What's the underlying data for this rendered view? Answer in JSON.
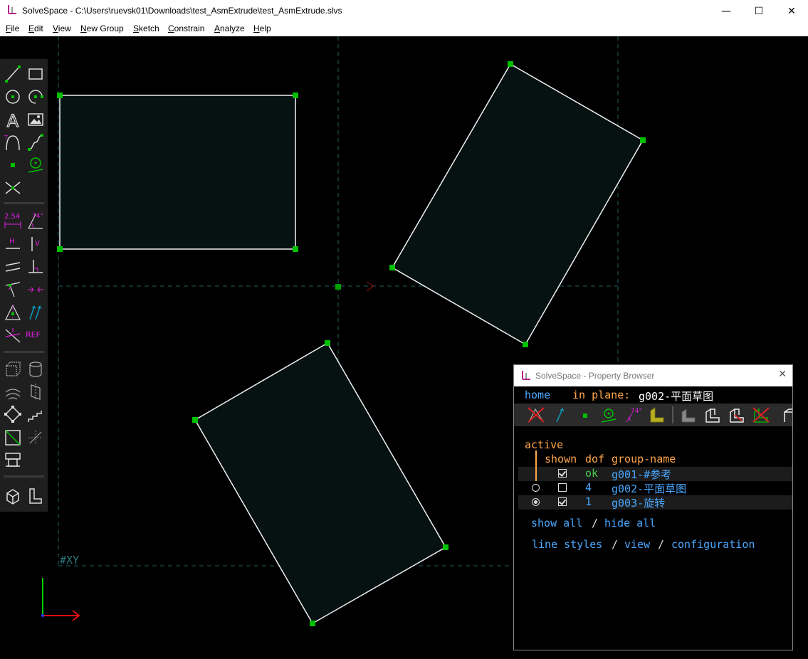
{
  "window": {
    "title": "SolveSpace - C:\\Users\\ruevsk01\\Downloads\\test_AsmExtrude\\test_AsmExtrude.slvs",
    "minimize": "—",
    "maximize": "☐",
    "close": "✕"
  },
  "menu": [
    {
      "u": "F",
      "rest": "ile"
    },
    {
      "u": "E",
      "rest": "dit"
    },
    {
      "u": "V",
      "rest": "iew"
    },
    {
      "u": "N",
      "rest": "ew Group"
    },
    {
      "u": "S",
      "rest": "ketch"
    },
    {
      "u": "C",
      "rest": "onstrain"
    },
    {
      "u": "A",
      "rest": "nalyze"
    },
    {
      "u": "H",
      "rest": "elp"
    }
  ],
  "toolbar": {
    "dim_label": "2.54",
    "angle_label": "74°",
    "horiz_label": "H",
    "vert_label": "V",
    "ref_label": "REF"
  },
  "canvas": {
    "plane_label": "#XY"
  },
  "property_browser": {
    "title": "SolveSpace - Property Browser",
    "close": "✕",
    "nav": {
      "home": "home",
      "in_plane_label": "in plane:",
      "in_plane_value": "g002-平面草图"
    },
    "angle_icon_label": "74°",
    "active_label": "active",
    "headers": {
      "shown": "shown",
      "dof": "dof",
      "name": "group-name"
    },
    "groups": [
      {
        "active": null,
        "shown": true,
        "dof": "ok",
        "name": "g001-#参考"
      },
      {
        "active": false,
        "shown": false,
        "dof": "4",
        "name": "g002-平面草图"
      },
      {
        "active": true,
        "shown": true,
        "dof": "1",
        "name": "g003-旋转"
      }
    ],
    "links": {
      "show_all": "show all",
      "sep1": "/",
      "hide_all": "hide all",
      "line_styles": "line styles",
      "sep2": "/",
      "view": "view",
      "sep3": "/",
      "configuration": "configuration"
    }
  },
  "colors": {
    "constraint_green": "#00d000",
    "constraint_magenta": "#e020e0",
    "link_blue": "#4aa8ff",
    "text_orange": "#ffa84a",
    "face_fill": "#061212",
    "axis_dashed": "#1a6060"
  }
}
